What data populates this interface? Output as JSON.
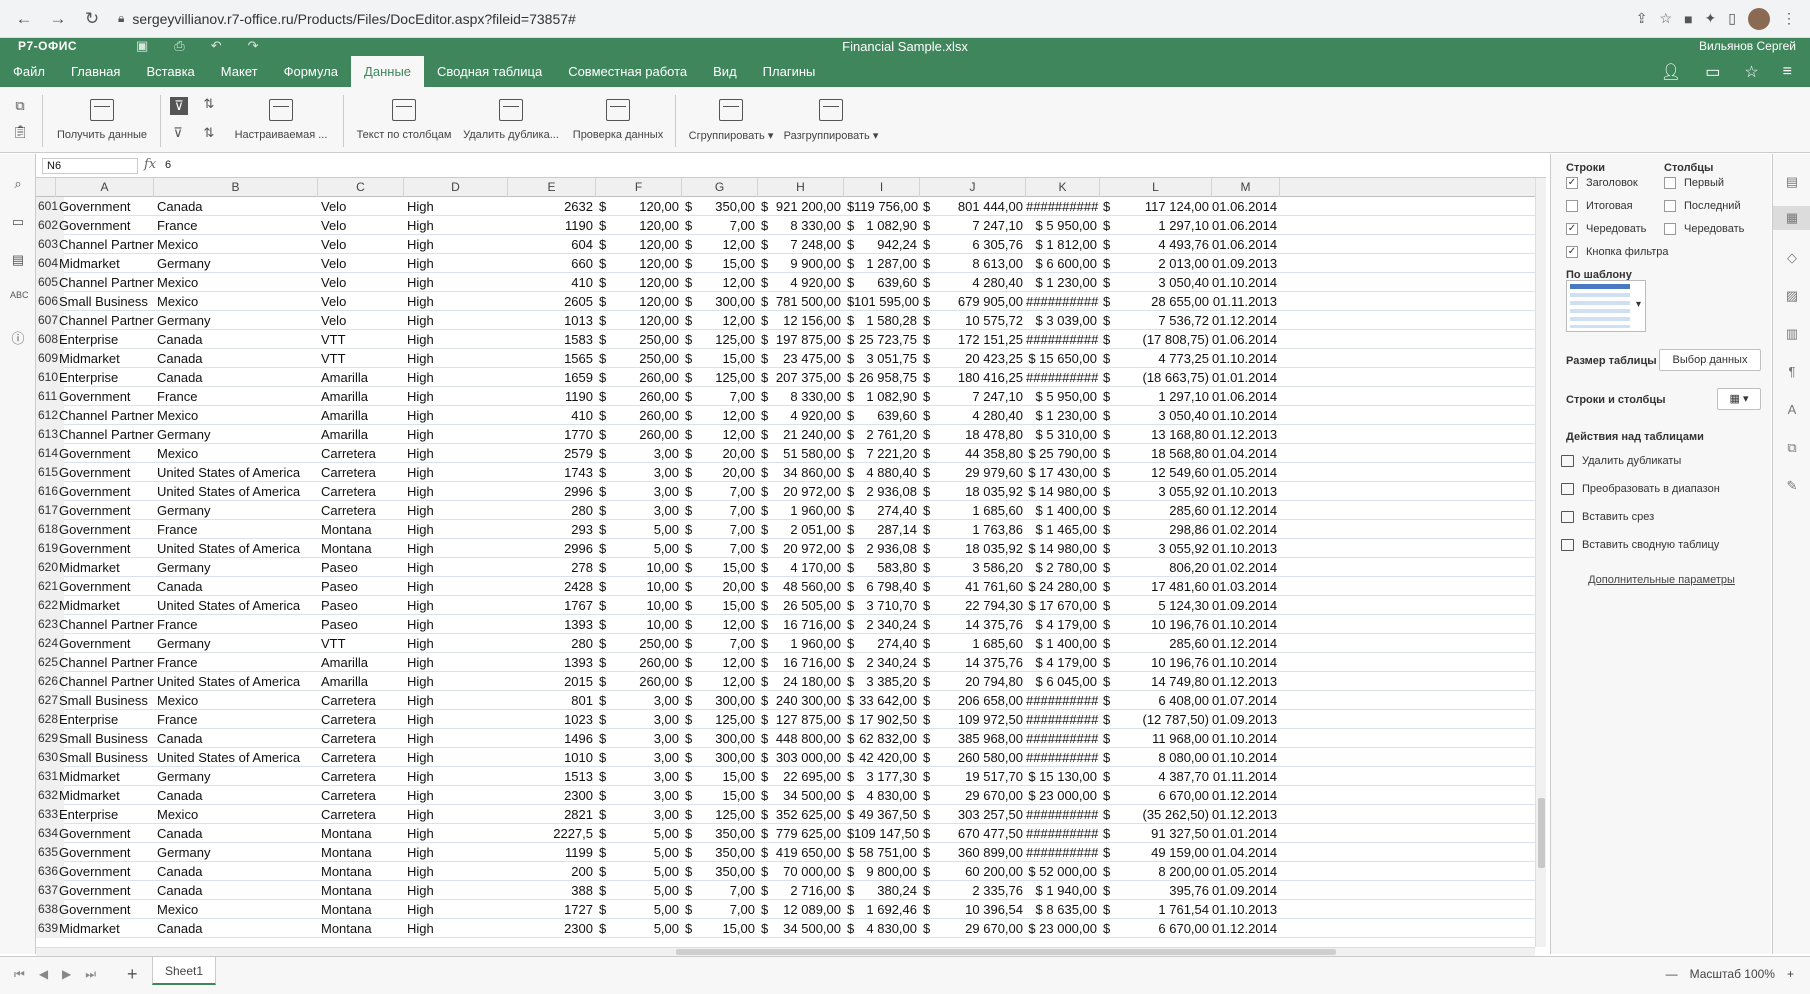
{
  "browser": {
    "url": "sergeyvillianov.r7-office.ru/Products/Files/DocEditor.aspx?fileid=73857#"
  },
  "titlebar": {
    "logo": "Р7-ОФИС",
    "document": "Financial Sample.xlsx",
    "user": "Вильянов Сергей"
  },
  "menu": {
    "tabs": [
      "Файл",
      "Главная",
      "Вставка",
      "Макет",
      "Формула",
      "Данные",
      "Сводная таблица",
      "Совместная работа",
      "Вид",
      "Плагины"
    ],
    "active": "Данные"
  },
  "toolbar": {
    "get_data": "Получить данные",
    "custom_sort": "Настраиваемая ...",
    "text_to_columns": "Текст по столбцам",
    "remove_duplicates": "Удалить дублика...",
    "data_validation": "Проверка данных",
    "group": "Сгруппировать",
    "ungroup": "Разгруппировать"
  },
  "formula": {
    "cell_ref": "N6",
    "fx": "fx",
    "value": "6"
  },
  "columns": [
    "A",
    "B",
    "C",
    "D",
    "E",
    "F",
    "G",
    "H",
    "I",
    "J",
    "K",
    "L",
    "M"
  ],
  "rows": [
    [
      "601",
      "Government",
      "Canada",
      "Velo",
      "High",
      "2632",
      "$",
      "120,00",
      "$",
      "350,00",
      "$",
      "921 200,00",
      "$",
      "119 756,00",
      "$",
      "801 444,00",
      "##########",
      "$",
      "117 124,00",
      "01.06.2014"
    ],
    [
      "602",
      "Government",
      "France",
      "Velo",
      "High",
      "1190",
      "$",
      "120,00",
      "$",
      "7,00",
      "$",
      "8 330,00",
      "$",
      "1 082,90",
      "$",
      "7 247,10",
      "$  5 950,00",
      "$",
      "1 297,10",
      "01.06.2014"
    ],
    [
      "603",
      "Channel Partners",
      "Mexico",
      "Velo",
      "High",
      "604",
      "$",
      "120,00",
      "$",
      "12,00",
      "$",
      "7 248,00",
      "$",
      "942,24",
      "$",
      "6 305,76",
      "$  1 812,00",
      "$",
      "4 493,76",
      "01.06.2014"
    ],
    [
      "604",
      "Midmarket",
      "Germany",
      "Velo",
      "High",
      "660",
      "$",
      "120,00",
      "$",
      "15,00",
      "$",
      "9 900,00",
      "$",
      "1 287,00",
      "$",
      "8 613,00",
      "$  6 600,00",
      "$",
      "2 013,00",
      "01.09.2013"
    ],
    [
      "605",
      "Channel Partners",
      "Mexico",
      "Velo",
      "High",
      "410",
      "$",
      "120,00",
      "$",
      "12,00",
      "$",
      "4 920,00",
      "$",
      "639,60",
      "$",
      "4 280,40",
      "$  1 230,00",
      "$",
      "3 050,40",
      "01.10.2014"
    ],
    [
      "606",
      "Small Business",
      "Mexico",
      "Velo",
      "High",
      "2605",
      "$",
      "120,00",
      "$",
      "300,00",
      "$",
      "781 500,00",
      "$",
      "101 595,00",
      "$",
      "679 905,00",
      "##########",
      "$",
      "28 655,00",
      "01.11.2013"
    ],
    [
      "607",
      "Channel Partners",
      "Germany",
      "Velo",
      "High",
      "1013",
      "$",
      "120,00",
      "$",
      "12,00",
      "$",
      "12 156,00",
      "$",
      "1 580,28",
      "$",
      "10 575,72",
      "$  3 039,00",
      "$",
      "7 536,72",
      "01.12.2014"
    ],
    [
      "608",
      "Enterprise",
      "Canada",
      "VTT",
      "High",
      "1583",
      "$",
      "250,00",
      "$",
      "125,00",
      "$",
      "197 875,00",
      "$",
      "25 723,75",
      "$",
      "172 151,25",
      "##########",
      "$",
      "(17 808,75)",
      "01.06.2014"
    ],
    [
      "609",
      "Midmarket",
      "Canada",
      "VTT",
      "High",
      "1565",
      "$",
      "250,00",
      "$",
      "15,00",
      "$",
      "23 475,00",
      "$",
      "3 051,75",
      "$",
      "20 423,25",
      "$ 15 650,00",
      "$",
      "4 773,25",
      "01.10.2014"
    ],
    [
      "610",
      "Enterprise",
      "Canada",
      "Amarilla",
      "High",
      "1659",
      "$",
      "260,00",
      "$",
      "125,00",
      "$",
      "207 375,00",
      "$",
      "26 958,75",
      "$",
      "180 416,25",
      "##########",
      "$",
      "(18 663,75)",
      "01.01.2014"
    ],
    [
      "611",
      "Government",
      "France",
      "Amarilla",
      "High",
      "1190",
      "$",
      "260,00",
      "$",
      "7,00",
      "$",
      "8 330,00",
      "$",
      "1 082,90",
      "$",
      "7 247,10",
      "$  5 950,00",
      "$",
      "1 297,10",
      "01.06.2014"
    ],
    [
      "612",
      "Channel Partners",
      "Mexico",
      "Amarilla",
      "High",
      "410",
      "$",
      "260,00",
      "$",
      "12,00",
      "$",
      "4 920,00",
      "$",
      "639,60",
      "$",
      "4 280,40",
      "$  1 230,00",
      "$",
      "3 050,40",
      "01.10.2014"
    ],
    [
      "613",
      "Channel Partners",
      "Germany",
      "Amarilla",
      "High",
      "1770",
      "$",
      "260,00",
      "$",
      "12,00",
      "$",
      "21 240,00",
      "$",
      "2 761,20",
      "$",
      "18 478,80",
      "$  5 310,00",
      "$",
      "13 168,80",
      "01.12.2013"
    ],
    [
      "614",
      "Government",
      "Mexico",
      "Carretera",
      "High",
      "2579",
      "$",
      "3,00",
      "$",
      "20,00",
      "$",
      "51 580,00",
      "$",
      "7 221,20",
      "$",
      "44 358,80",
      "$ 25 790,00",
      "$",
      "18 568,80",
      "01.04.2014"
    ],
    [
      "615",
      "Government",
      "United States of America",
      "Carretera",
      "High",
      "1743",
      "$",
      "3,00",
      "$",
      "20,00",
      "$",
      "34 860,00",
      "$",
      "4 880,40",
      "$",
      "29 979,60",
      "$ 17 430,00",
      "$",
      "12 549,60",
      "01.05.2014"
    ],
    [
      "616",
      "Government",
      "United States of America",
      "Carretera",
      "High",
      "2996",
      "$",
      "3,00",
      "$",
      "7,00",
      "$",
      "20 972,00",
      "$",
      "2 936,08",
      "$",
      "18 035,92",
      "$ 14 980,00",
      "$",
      "3 055,92",
      "01.10.2013"
    ],
    [
      "617",
      "Government",
      "Germany",
      "Carretera",
      "High",
      "280",
      "$",
      "3,00",
      "$",
      "7,00",
      "$",
      "1 960,00",
      "$",
      "274,40",
      "$",
      "1 685,60",
      "$  1 400,00",
      "$",
      "285,60",
      "01.12.2014"
    ],
    [
      "618",
      "Government",
      "France",
      "Montana",
      "High",
      "293",
      "$",
      "5,00",
      "$",
      "7,00",
      "$",
      "2 051,00",
      "$",
      "287,14",
      "$",
      "1 763,86",
      "$  1 465,00",
      "$",
      "298,86",
      "01.02.2014"
    ],
    [
      "619",
      "Government",
      "United States of America",
      "Montana",
      "High",
      "2996",
      "$",
      "5,00",
      "$",
      "7,00",
      "$",
      "20 972,00",
      "$",
      "2 936,08",
      "$",
      "18 035,92",
      "$ 14 980,00",
      "$",
      "3 055,92",
      "01.10.2013"
    ],
    [
      "620",
      "Midmarket",
      "Germany",
      "Paseo",
      "High",
      "278",
      "$",
      "10,00",
      "$",
      "15,00",
      "$",
      "4 170,00",
      "$",
      "583,80",
      "$",
      "3 586,20",
      "$  2 780,00",
      "$",
      "806,20",
      "01.02.2014"
    ],
    [
      "621",
      "Government",
      "Canada",
      "Paseo",
      "High",
      "2428",
      "$",
      "10,00",
      "$",
      "20,00",
      "$",
      "48 560,00",
      "$",
      "6 798,40",
      "$",
      "41 761,60",
      "$ 24 280,00",
      "$",
      "17 481,60",
      "01.03.2014"
    ],
    [
      "622",
      "Midmarket",
      "United States of America",
      "Paseo",
      "High",
      "1767",
      "$",
      "10,00",
      "$",
      "15,00",
      "$",
      "26 505,00",
      "$",
      "3 710,70",
      "$",
      "22 794,30",
      "$ 17 670,00",
      "$",
      "5 124,30",
      "01.09.2014"
    ],
    [
      "623",
      "Channel Partners",
      "France",
      "Paseo",
      "High",
      "1393",
      "$",
      "10,00",
      "$",
      "12,00",
      "$",
      "16 716,00",
      "$",
      "2 340,24",
      "$",
      "14 375,76",
      "$  4 179,00",
      "$",
      "10 196,76",
      "01.10.2014"
    ],
    [
      "624",
      "Government",
      "Germany",
      "VTT",
      "High",
      "280",
      "$",
      "250,00",
      "$",
      "7,00",
      "$",
      "1 960,00",
      "$",
      "274,40",
      "$",
      "1 685,60",
      "$  1 400,00",
      "$",
      "285,60",
      "01.12.2014"
    ],
    [
      "625",
      "Channel Partners",
      "France",
      "Amarilla",
      "High",
      "1393",
      "$",
      "260,00",
      "$",
      "12,00",
      "$",
      "16 716,00",
      "$",
      "2 340,24",
      "$",
      "14 375,76",
      "$  4 179,00",
      "$",
      "10 196,76",
      "01.10.2014"
    ],
    [
      "626",
      "Channel Partners",
      "United States of America",
      "Amarilla",
      "High",
      "2015",
      "$",
      "260,00",
      "$",
      "12,00",
      "$",
      "24 180,00",
      "$",
      "3 385,20",
      "$",
      "20 794,80",
      "$  6 045,00",
      "$",
      "14 749,80",
      "01.12.2013"
    ],
    [
      "627",
      "Small Business",
      "Mexico",
      "Carretera",
      "High",
      "801",
      "$",
      "3,00",
      "$",
      "300,00",
      "$",
      "240 300,00",
      "$",
      "33 642,00",
      "$",
      "206 658,00",
      "##########",
      "$",
      "6 408,00",
      "01.07.2014"
    ],
    [
      "628",
      "Enterprise",
      "France",
      "Carretera",
      "High",
      "1023",
      "$",
      "3,00",
      "$",
      "125,00",
      "$",
      "127 875,00",
      "$",
      "17 902,50",
      "$",
      "109 972,50",
      "##########",
      "$",
      "(12 787,50)",
      "01.09.2013"
    ],
    [
      "629",
      "Small Business",
      "Canada",
      "Carretera",
      "High",
      "1496",
      "$",
      "3,00",
      "$",
      "300,00",
      "$",
      "448 800,00",
      "$",
      "62 832,00",
      "$",
      "385 968,00",
      "##########",
      "$",
      "11 968,00",
      "01.10.2014"
    ],
    [
      "630",
      "Small Business",
      "United States of America",
      "Carretera",
      "High",
      "1010",
      "$",
      "3,00",
      "$",
      "300,00",
      "$",
      "303 000,00",
      "$",
      "42 420,00",
      "$",
      "260 580,00",
      "##########",
      "$",
      "8 080,00",
      "01.10.2014"
    ],
    [
      "631",
      "Midmarket",
      "Germany",
      "Carretera",
      "High",
      "1513",
      "$",
      "3,00",
      "$",
      "15,00",
      "$",
      "22 695,00",
      "$",
      "3 177,30",
      "$",
      "19 517,70",
      "$ 15 130,00",
      "$",
      "4 387,70",
      "01.11.2014"
    ],
    [
      "632",
      "Midmarket",
      "Canada",
      "Carretera",
      "High",
      "2300",
      "$",
      "3,00",
      "$",
      "15,00",
      "$",
      "34 500,00",
      "$",
      "4 830,00",
      "$",
      "29 670,00",
      "$ 23 000,00",
      "$",
      "6 670,00",
      "01.12.2014"
    ],
    [
      "633",
      "Enterprise",
      "Mexico",
      "Carretera",
      "High",
      "2821",
      "$",
      "3,00",
      "$",
      "125,00",
      "$",
      "352 625,00",
      "$",
      "49 367,50",
      "$",
      "303 257,50",
      "##########",
      "$",
      "(35 262,50)",
      "01.12.2013"
    ],
    [
      "634",
      "Government",
      "Canada",
      "Montana",
      "High",
      "2227,5",
      "$",
      "5,00",
      "$",
      "350,00",
      "$",
      "779 625,00",
      "$",
      "109 147,50",
      "$",
      "670 477,50",
      "##########",
      "$",
      "91 327,50",
      "01.01.2014"
    ],
    [
      "635",
      "Government",
      "Germany",
      "Montana",
      "High",
      "1199",
      "$",
      "5,00",
      "$",
      "350,00",
      "$",
      "419 650,00",
      "$",
      "58 751,00",
      "$",
      "360 899,00",
      "##########",
      "$",
      "49 159,00",
      "01.04.2014"
    ],
    [
      "636",
      "Government",
      "Canada",
      "Montana",
      "High",
      "200",
      "$",
      "5,00",
      "$",
      "350,00",
      "$",
      "70 000,00",
      "$",
      "9 800,00",
      "$",
      "60 200,00",
      "$ 52 000,00",
      "$",
      "8 200,00",
      "01.05.2014"
    ],
    [
      "637",
      "Government",
      "Canada",
      "Montana",
      "High",
      "388",
      "$",
      "5,00",
      "$",
      "7,00",
      "$",
      "2 716,00",
      "$",
      "380,24",
      "$",
      "2 335,76",
      "$  1 940,00",
      "$",
      "395,76",
      "01.09.2014"
    ],
    [
      "638",
      "Government",
      "Mexico",
      "Montana",
      "High",
      "1727",
      "$",
      "5,00",
      "$",
      "7,00",
      "$",
      "12 089,00",
      "$",
      "1 692,46",
      "$",
      "10 396,54",
      "$  8 635,00",
      "$",
      "1 761,54",
      "01.10.2013"
    ],
    [
      "639",
      "Midmarket",
      "Canada",
      "Montana",
      "High",
      "2300",
      "$",
      "5,00",
      "$",
      "15,00",
      "$",
      "34 500,00",
      "$",
      "4 830,00",
      "$",
      "29 670,00",
      "$ 23 000,00",
      "$",
      "6 670,00",
      "01.12.2014"
    ]
  ],
  "panel": {
    "rows_title": "Строки",
    "cols_title": "Столбцы",
    "rows_opts": [
      {
        "label": "Заголовок",
        "checked": true
      },
      {
        "label": "Итоговая",
        "checked": false
      },
      {
        "label": "Чередовать",
        "checked": true
      },
      {
        "label": "Кнопка фильтра",
        "checked": true
      }
    ],
    "cols_opts": [
      {
        "label": "Первый",
        "checked": false
      },
      {
        "label": "Последний",
        "checked": false
      },
      {
        "label": "Чередовать",
        "checked": false
      }
    ],
    "template_title": "По шаблону",
    "size_title": "Размер таблицы",
    "select_data": "Выбор данных",
    "rows_cols_title": "Строки и столбцы",
    "actions_title": "Действия над таблицами",
    "actions": [
      "Удалить дубликаты",
      "Преобразовать в диапазон",
      "Вставить срез",
      "Вставить сводную таблицу"
    ],
    "more": "Дополнительные параметры"
  },
  "bottom": {
    "sheet": "Sheet1",
    "zoom": "Масштаб 100%"
  }
}
